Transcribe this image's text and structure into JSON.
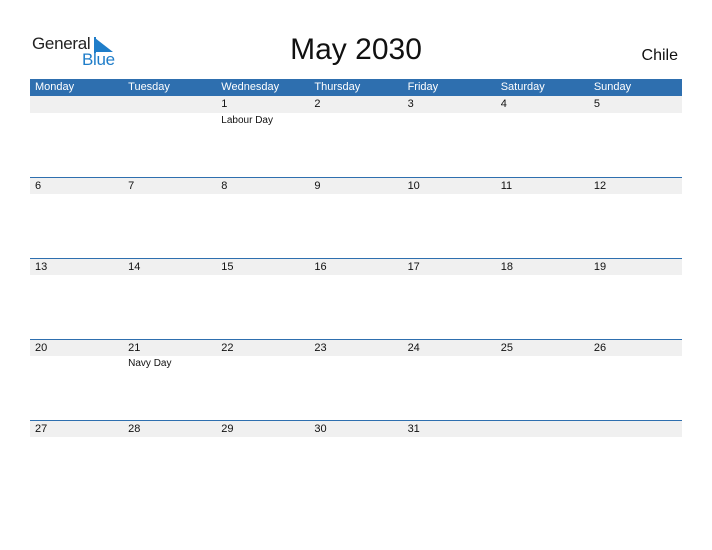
{
  "logo": {
    "text1": "General",
    "text2": "Blue"
  },
  "title": "May 2030",
  "country": "Chile",
  "colors": {
    "accent": "#2e6faf",
    "logo_blue": "#1f7dc9",
    "day_row_bg": "#f0f0f0"
  },
  "weekdays": [
    "Monday",
    "Tuesday",
    "Wednesday",
    "Thursday",
    "Friday",
    "Saturday",
    "Sunday"
  ],
  "weeks": [
    {
      "days": [
        "",
        "",
        "1",
        "2",
        "3",
        "4",
        "5"
      ],
      "events": [
        "",
        "",
        "Labour Day",
        "",
        "",
        "",
        ""
      ]
    },
    {
      "days": [
        "6",
        "7",
        "8",
        "9",
        "10",
        "11",
        "12"
      ],
      "events": [
        "",
        "",
        "",
        "",
        "",
        "",
        ""
      ]
    },
    {
      "days": [
        "13",
        "14",
        "15",
        "16",
        "17",
        "18",
        "19"
      ],
      "events": [
        "",
        "",
        "",
        "",
        "",
        "",
        ""
      ]
    },
    {
      "days": [
        "20",
        "21",
        "22",
        "23",
        "24",
        "25",
        "26"
      ],
      "events": [
        "",
        "Navy Day",
        "",
        "",
        "",
        "",
        ""
      ]
    },
    {
      "days": [
        "27",
        "28",
        "29",
        "30",
        "31",
        "",
        ""
      ],
      "events": [
        "",
        "",
        "",
        "",
        "",
        "",
        ""
      ]
    }
  ]
}
